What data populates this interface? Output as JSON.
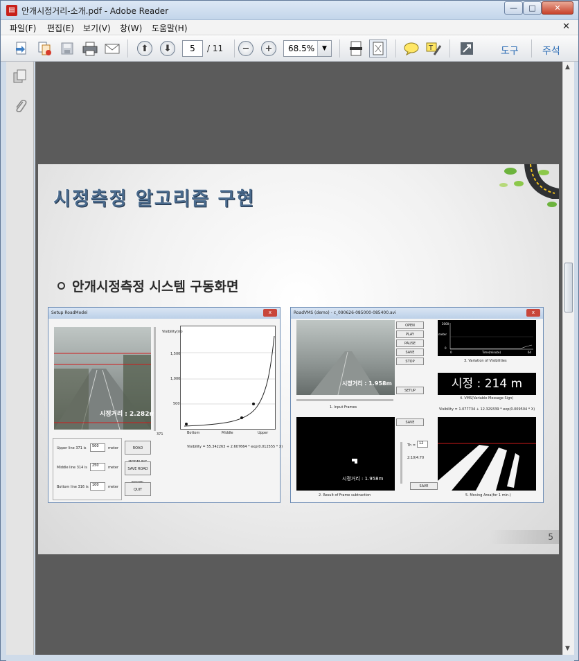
{
  "window": {
    "title": "안개시정거리-소개.pdf - Adobe Reader",
    "app_icon": "pdf-icon",
    "min": "—",
    "max": "□",
    "close": "✕"
  },
  "menu": {
    "items": [
      "파일(F)",
      "편집(E)",
      "보기(V)",
      "창(W)",
      "도움말(H)"
    ],
    "close": "✕"
  },
  "toolbar": {
    "page_current": "5",
    "page_total": "/ 11",
    "zoom": "68.5%",
    "tools_label": "도구",
    "comment_label": "주석"
  },
  "slide": {
    "title": "시정측정 알고리즘 구현",
    "bullet": "안개시정측정 시스템 구동화면",
    "page_number": "5",
    "left_window": {
      "caption": "Setup RoadModel",
      "overlay_distance": "시정거리 : 2.282m",
      "axis_y": "Visibility(m)",
      "y_ticks": [
        "1,500",
        "1,000",
        "500"
      ],
      "x_ticks": [
        "Bottom",
        "Middle",
        "Upper"
      ],
      "slider_value": "371",
      "formula": "Visibility = 55.342263 + 2.607664 * exp(0.012555 * X)",
      "lines": [
        {
          "label": "Upper line 371 is",
          "value": "500",
          "unit": "meter"
        },
        {
          "label": "Middle line 314 is",
          "value": "250",
          "unit": "meter"
        },
        {
          "label": "Bottom line 316 is",
          "value": "100",
          "unit": "meter"
        }
      ],
      "buttons": [
        "ROAD MODELING",
        "SAVE ROAD MODEL",
        "QUIT"
      ]
    },
    "right_window": {
      "caption": "RoadVMS (demo) - c_090626-085000-085400.avi",
      "overlay_distance": "시정거리 : 1.958m",
      "buttons": [
        "OPEN",
        "PLAY",
        "PAUSE",
        "SAVE",
        "STOP",
        "SETUP",
        "SAVE",
        "SAVE"
      ],
      "labels": [
        "1. Input Frames",
        "2. Result of Frame subtraction",
        "3. Variation of Visibilities",
        "4. VMS(Variable Message Sign)",
        "5. Moving Area(for 1 min.)"
      ],
      "vms": "시정 : 214 m",
      "formula": "Visibility = 1.077734 + 12.329339 * exp(0.009504 * X)",
      "th_label": "Th =",
      "th_value": "12",
      "time": "2:10/4:70",
      "chart_axis_x": "Time(minute)",
      "chart_axis_y": "meter",
      "chart_y_max": "2000",
      "chart_y_min": "0",
      "chart_x_min": "0",
      "chart_x_max": "64",
      "subtraction_overlay": "시정거리 : 1.958m"
    }
  },
  "sidebar": {
    "icons": [
      "pages-icon",
      "attachment-icon"
    ]
  }
}
